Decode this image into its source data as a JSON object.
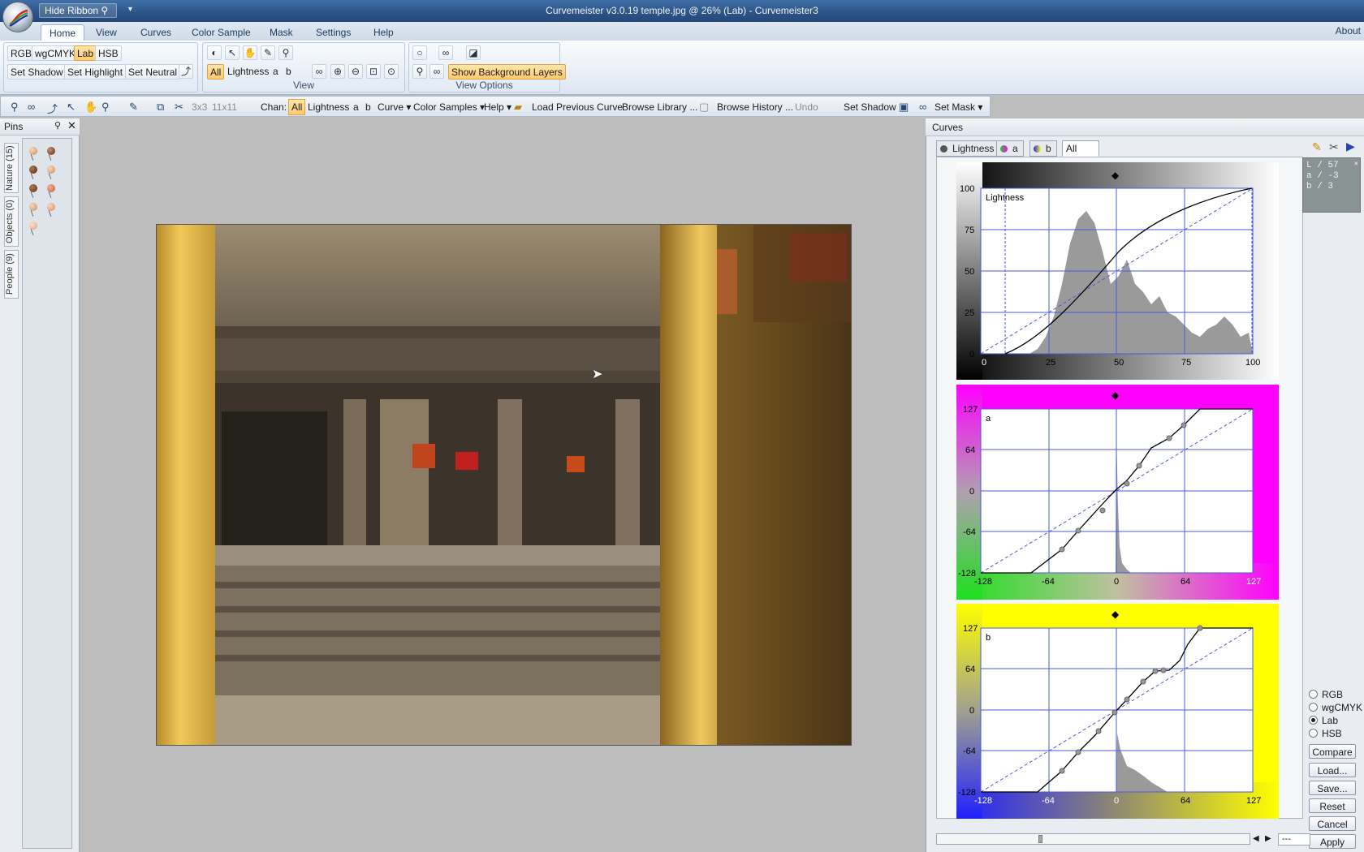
{
  "window": {
    "title": "Curvemeister v3.0.19      temple.jpg @ 26% (Lab) - Curvemeister3",
    "hide_ribbon": "Hide Ribbon"
  },
  "ribbon": {
    "tabs": [
      "Home",
      "View",
      "Curves",
      "Color Sample",
      "Mask",
      "Settings",
      "Help"
    ],
    "active_tab": "Home",
    "about": "About",
    "modes": [
      "RGB",
      "wgCMYK",
      "Lab",
      "HSB"
    ],
    "selected_mode": "Lab",
    "set_buttons": [
      "Set Shadow",
      "Set Highlight",
      "Set Neutral"
    ],
    "view_channels": [
      "All",
      "Lightness",
      "a",
      "b"
    ],
    "view_label": "View",
    "view_options_label": "View Options",
    "show_bg_layers": "Show Background Layers"
  },
  "toolbar": {
    "sample_sizes": [
      "3x3",
      "11x11"
    ],
    "chan_label": "Chan:",
    "channels": [
      "All",
      "Lightness",
      "a",
      "b"
    ],
    "menus": [
      "Curve",
      "Color Samples",
      "Help"
    ],
    "load_prev": "Load Previous Curve",
    "browse_lib": "Browse Library ...",
    "browse_hist": "Browse History ...",
    "undo": "Undo",
    "set_shadow": "Set Shadow",
    "set_mask": "Set Mask"
  },
  "pins": {
    "title": "Pins",
    "tabs": [
      "Nature (15)",
      "Objects (0)",
      "People (9)"
    ]
  },
  "curves": {
    "title": "Curves",
    "tabs": [
      "Lightness",
      "a",
      "b",
      "All"
    ],
    "active_tab": "All",
    "graphs": [
      {
        "label": "Lightness",
        "y_ticks": [
          "100",
          "75",
          "50",
          "25",
          "0"
        ],
        "x_ticks": [
          "0",
          "25",
          "50",
          "75",
          "100"
        ]
      },
      {
        "label": "a",
        "y_ticks": [
          "127",
          "64",
          "0",
          "-64",
          "-128"
        ],
        "x_ticks": [
          "-128",
          "-64",
          "0",
          "64",
          "127"
        ]
      },
      {
        "label": "b",
        "y_ticks": [
          "127",
          "64",
          "0",
          "-64",
          "-128"
        ],
        "x_ticks": [
          "-128",
          "-64",
          "0",
          "64",
          "127"
        ]
      }
    ],
    "readout": {
      "L": "57",
      "a": "-3",
      "b": "3"
    },
    "color_models": [
      "RGB",
      "wgCMYK",
      "Lab",
      "HSB"
    ],
    "selected_model": "Lab",
    "buttons": [
      "Compare",
      "Load...",
      "Save...",
      "Reset",
      "Cancel",
      "Apply"
    ],
    "zoom_field": "---"
  },
  "colors": {
    "accent": "#ffc970",
    "graph_grid": "#4a5ae0",
    "a_neg": "#22dd22",
    "a_pos": "#ff00ff",
    "b_neg": "#2222ff",
    "b_pos": "#ffff00"
  }
}
